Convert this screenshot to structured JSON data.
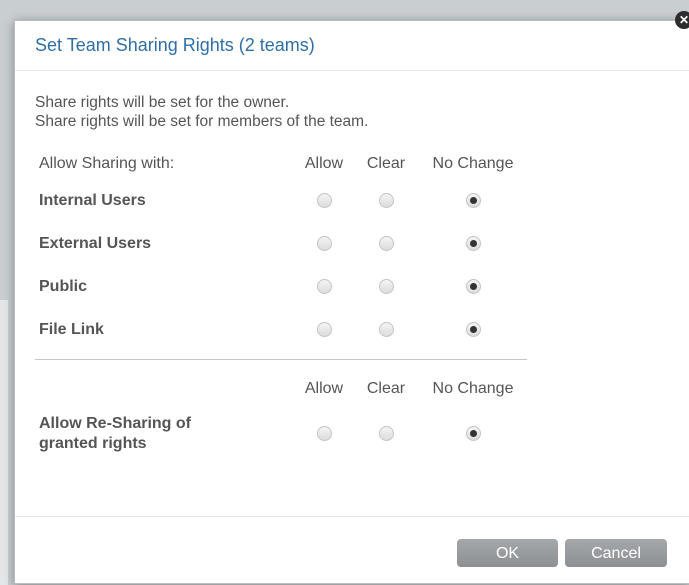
{
  "dialog": {
    "title": "Set Team Sharing Rights (2 teams)",
    "info_lines": [
      "Share rights will be set for the owner.",
      "Share rights will be set for members of the team."
    ],
    "sharing_header": {
      "label": "Allow Sharing with:",
      "allow": "Allow",
      "clear": "Clear",
      "no_change": "No Change"
    },
    "rows": [
      {
        "label": "Internal Users",
        "selected": "no_change"
      },
      {
        "label": "External Users",
        "selected": "no_change"
      },
      {
        "label": "Public",
        "selected": "no_change"
      },
      {
        "label": "File Link",
        "selected": "no_change"
      }
    ],
    "resharing_header": {
      "allow": "Allow",
      "clear": "Clear",
      "no_change": "No Change"
    },
    "resharing_row": {
      "label_line1": "Allow Re-Sharing of",
      "label_line2": "granted rights",
      "selected": "no_change"
    },
    "buttons": {
      "ok": "OK",
      "cancel": "Cancel"
    },
    "close_icon": "close-icon"
  },
  "colors": {
    "title": "#2f6fa6",
    "button": "#9a9ea1",
    "backdrop": "#c9ced1"
  }
}
